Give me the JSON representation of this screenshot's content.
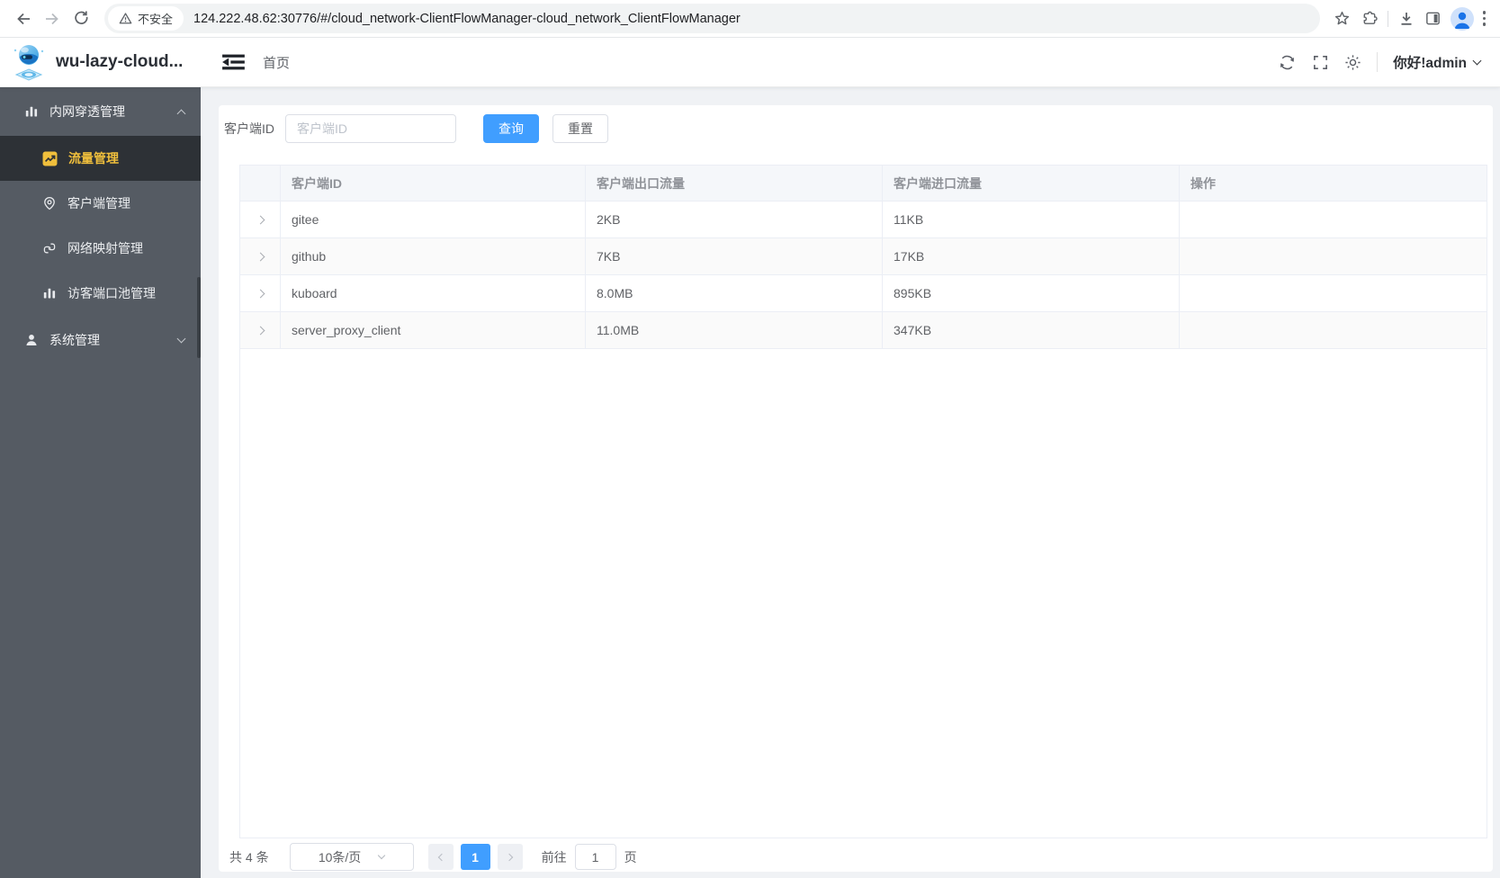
{
  "browser": {
    "security_label": "不安全",
    "url": "124.222.48.62:30776/#/cloud_network-ClientFlowManager-cloud_network_ClientFlowManager"
  },
  "header": {
    "app_title": "wu-lazy-cloud...",
    "breadcrumb": "首页",
    "greeting": "你好!admin"
  },
  "sidebar": {
    "groups": [
      {
        "label": "内网穿透管理",
        "expanded": true,
        "items": [
          {
            "label": "流量管理",
            "active": true
          },
          {
            "label": "客户端管理",
            "active": false
          },
          {
            "label": "网络映射管理",
            "active": false
          },
          {
            "label": "访客端口池管理",
            "active": false
          }
        ]
      },
      {
        "label": "系统管理",
        "expanded": false,
        "items": []
      }
    ]
  },
  "filters": {
    "label": "客户端ID",
    "placeholder": "客户端ID",
    "search_label": "查询",
    "reset_label": "重置"
  },
  "table": {
    "columns": [
      "客户端ID",
      "客户端出口流量",
      "客户端进口流量",
      "操作"
    ],
    "rows": [
      {
        "client_id": "gitee",
        "outflow": "2KB",
        "inflow": "11KB"
      },
      {
        "client_id": "github",
        "outflow": "7KB",
        "inflow": "17KB"
      },
      {
        "client_id": "kuboard",
        "outflow": "8.0MB",
        "inflow": "895KB"
      },
      {
        "client_id": "server_proxy_client",
        "outflow": "11.0MB",
        "inflow": "347KB"
      }
    ]
  },
  "pagination": {
    "total": "共 4 条",
    "page_size": "10条/页",
    "current_page": "1",
    "goto_label": "前往",
    "goto_value": "1",
    "unit_label": "页"
  },
  "icons": {
    "back-icon": "left arrow",
    "forward-icon": "right arrow",
    "reload-icon": "circular arrow",
    "warning-icon": "triangle exclamation",
    "bookmark-star-icon": "star outline",
    "extensions-icon": "puzzle piece",
    "download-icon": "arrow into tray",
    "side-panel-icon": "split rectangle",
    "profile-icon": "person in circle",
    "menu-dots-icon": "vertical ellipsis",
    "logo-icon": "blue robot on platform",
    "fold-icon": "indent collapse lines",
    "refresh-icon": "circular arrows",
    "fullscreen-icon": "corner brackets",
    "theme-icon": "sun",
    "bar-chart-icon": "vertical bars",
    "trend-chart-icon": "gold square with zigzag line",
    "map-pin-icon": "location pin",
    "link-icon": "interlocked chain links",
    "user-icon": "person silhouette",
    "expand-row-icon": "chevron right"
  },
  "colors": {
    "primary": "#409eff",
    "sidebar_bg": "#555b63",
    "sidebar_active_bg": "#2d3136",
    "sidebar_active_text": "#f0bf3c",
    "page_bg": "#f0f2f5",
    "table_border": "#ebeef5",
    "table_header_text": "#909399",
    "body_text": "#606266"
  }
}
